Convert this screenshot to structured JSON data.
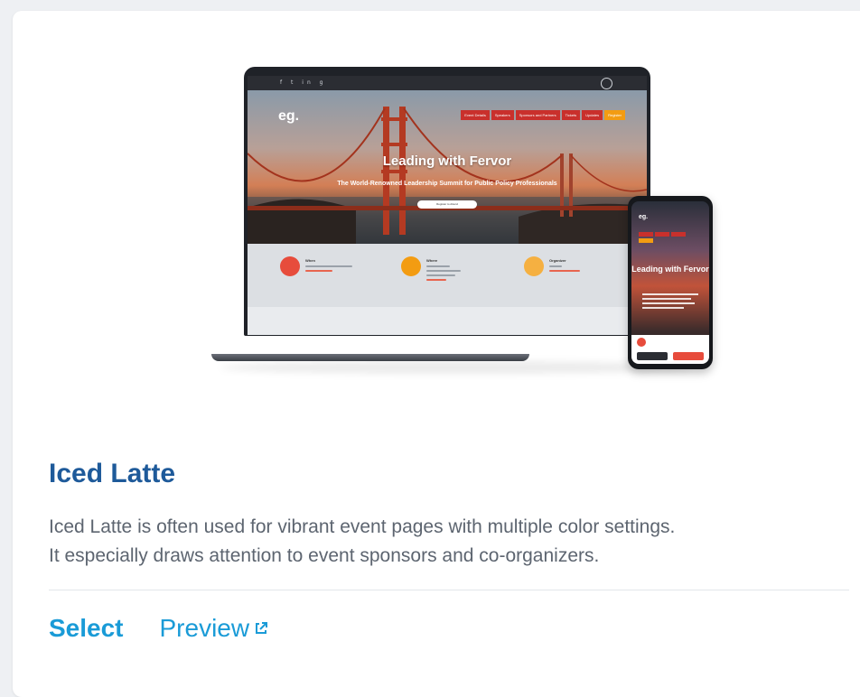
{
  "preview": {
    "mockup_website": {
      "logo": "eg.",
      "nav_items": [
        {
          "label": "Event Details",
          "color": "#c9302c"
        },
        {
          "label": "Speakers",
          "color": "#c9302c"
        },
        {
          "label": "Sponsors and Partners",
          "color": "#c9302c"
        },
        {
          "label": "Tickets",
          "color": "#c9302c"
        },
        {
          "label": "Updates",
          "color": "#c9302c"
        },
        {
          "label": "Register",
          "color": "#f39c12"
        }
      ],
      "hero_title": "Leading with Fervor",
      "hero_subtitle": "The World-Renowned Leadership Summit for Public Policy Professionals",
      "hero_button": "Register to Attend",
      "info": [
        {
          "label": "When",
          "icon": "calendar-icon",
          "color": "#e74c3c"
        },
        {
          "label": "Where",
          "icon": "location-pin-icon",
          "color": "#f39c12"
        },
        {
          "label": "Organizer",
          "icon": "edit-icon",
          "color": "#f5b041"
        }
      ]
    },
    "mockup_phone": {
      "logo": "eg.",
      "hero_title": "Leading with Fervor"
    }
  },
  "template": {
    "title": "Iced Latte",
    "description_line1": "Iced Latte is often used for vibrant event pages with multiple color settings.",
    "description_line2": "It especially draws attention to event sponsors and co-organizers."
  },
  "actions": {
    "select_label": "Select",
    "preview_label": "Preview",
    "preview_icon": "external-link-icon"
  },
  "colors": {
    "title": "#1e5a9a",
    "accent": "#1a9bd7",
    "body_text": "#5d6570"
  }
}
